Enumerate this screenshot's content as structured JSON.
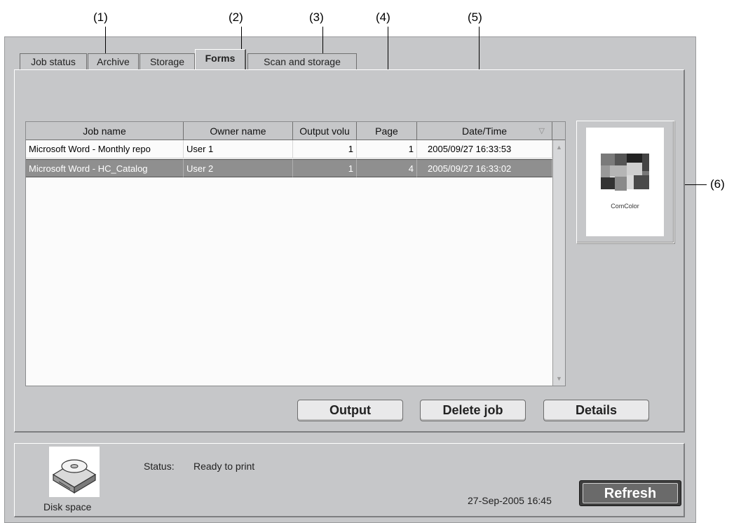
{
  "callouts": [
    "(1)",
    "(2)",
    "(3)",
    "(4)",
    "(5)",
    "(6)"
  ],
  "tabs": [
    {
      "label": "Job status"
    },
    {
      "label": "Archive"
    },
    {
      "label": "Storage"
    },
    {
      "label": "Forms"
    },
    {
      "label": "Scan and storage"
    }
  ],
  "active_tab": "Forms",
  "table": {
    "headers": [
      "Job name",
      "Owner name",
      "Output volu",
      "Page",
      "Date/Time"
    ],
    "sort_column": "Date/Time",
    "rows": [
      {
        "job": "Microsoft Word - Monthly repo",
        "owner": "User 1",
        "output": "1",
        "page": "1",
        "datetime": "2005/09/27 16:33:53",
        "selected": false
      },
      {
        "job": "Microsoft Word - HC_Catalog",
        "owner": "User 2",
        "output": "1",
        "page": "4",
        "datetime": "2005/09/27 16:33:02",
        "selected": true
      }
    ]
  },
  "preview": {
    "logo_text": "ComColor"
  },
  "buttons": {
    "output": "Output",
    "delete": "Delete job",
    "details": "Details"
  },
  "status": {
    "disk_label": "Disk space",
    "status_label": "Status:",
    "status_value": "Ready to print",
    "timestamp": "27-Sep-2005 16:45",
    "refresh": "Refresh"
  }
}
